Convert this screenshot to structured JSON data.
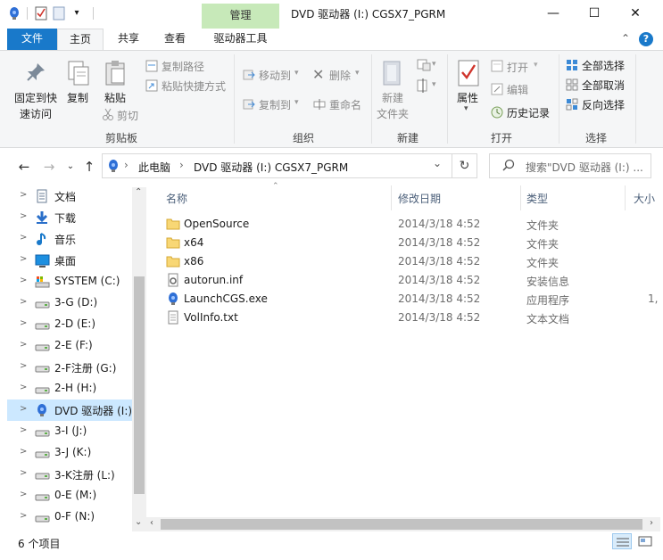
{
  "window": {
    "title": "DVD 驱动器 (I:) CGSX7_PGRM",
    "context_tab": "管理",
    "minimize": "—",
    "maximize": "☐",
    "close": "✕"
  },
  "tabs": {
    "file": "文件",
    "home": "主页",
    "share": "共享",
    "view": "查看",
    "drive_tools": "驱动器工具",
    "collapse": "⌃",
    "help": "?"
  },
  "ribbon": {
    "pin_quick_access": [
      "固定到快",
      "速访问"
    ],
    "copy": "复制",
    "paste": "粘贴",
    "copy_path": "复制路径",
    "paste_shortcut": "粘贴快捷方式",
    "cut": "剪切",
    "clipboard_group": "剪贴板",
    "move_to": "移动到",
    "copy_to": "复制到",
    "delete": "删除",
    "rename": "重命名",
    "organize_group": "组织",
    "new_folder": [
      "新建",
      "文件夹"
    ],
    "new_group": "新建",
    "properties": "属性",
    "open": "打开",
    "edit": "编辑",
    "history": "历史记录",
    "open_group": "打开",
    "select_all": "全部选择",
    "select_none": "全部取消",
    "invert_selection": "反向选择",
    "select_group": "选择"
  },
  "address": {
    "back": "←",
    "forward": "→",
    "recent": "⌄",
    "up": "↑",
    "sep": "›",
    "crumb_pc": "此电脑",
    "crumb_drive": "DVD 驱动器 (I:) CGSX7_PGRM",
    "dropdown": "⌄",
    "refresh": "↻",
    "search_placeholder": "搜索\"DVD 驱动器 (I:) ..."
  },
  "nav_items": [
    {
      "label": "文档",
      "icon": "documents-icon"
    },
    {
      "label": "下载",
      "icon": "downloads-icon"
    },
    {
      "label": "音乐",
      "icon": "music-icon"
    },
    {
      "label": "桌面",
      "icon": "desktop-icon"
    },
    {
      "label": "SYSTEM (C:)",
      "icon": "system-drive-icon"
    },
    {
      "label": "3-G (D:)",
      "icon": "drive-icon"
    },
    {
      "label": "2-D (E:)",
      "icon": "drive-icon"
    },
    {
      "label": "2-E (F:)",
      "icon": "drive-icon"
    },
    {
      "label": "2-F注册 (G:)",
      "icon": "drive-icon"
    },
    {
      "label": "2-H (H:)",
      "icon": "drive-icon"
    },
    {
      "label": "DVD 驱动器 (I:)",
      "icon": "dvd-drive-icon"
    },
    {
      "label": "3-I (J:)",
      "icon": "drive-icon"
    },
    {
      "label": "3-J (K:)",
      "icon": "drive-icon"
    },
    {
      "label": "3-K注册 (L:)",
      "icon": "drive-icon"
    },
    {
      "label": "0-E (M:)",
      "icon": "drive-icon"
    },
    {
      "label": "0-F (N:)",
      "icon": "drive-icon"
    }
  ],
  "columns": {
    "name": "名称",
    "date": "修改日期",
    "type": "类型",
    "size": "大小"
  },
  "files": [
    {
      "name": "OpenSource",
      "date": "2014/3/18 4:52",
      "type": "文件夹",
      "size": "",
      "icon": "folder-icon"
    },
    {
      "name": "x64",
      "date": "2014/3/18 4:52",
      "type": "文件夹",
      "size": "",
      "icon": "folder-icon"
    },
    {
      "name": "x86",
      "date": "2014/3/18 4:52",
      "type": "文件夹",
      "size": "",
      "icon": "folder-icon"
    },
    {
      "name": "autorun.inf",
      "date": "2014/3/18 4:52",
      "type": "安装信息",
      "size": "",
      "icon": "settings-file-icon"
    },
    {
      "name": "LaunchCGS.exe",
      "date": "2014/3/18 4:52",
      "type": "应用程序",
      "size": "1,",
      "icon": "app-icon"
    },
    {
      "name": "VolInfo.txt",
      "date": "2014/3/18 4:52",
      "type": "文本文档",
      "size": "",
      "icon": "text-file-icon"
    }
  ],
  "status": {
    "count": "6 个项目"
  },
  "colors": {
    "accent": "#1979ca",
    "manage_tab": "#c7e9b9",
    "selection": "#cce8ff",
    "folder": "#f8d775"
  }
}
